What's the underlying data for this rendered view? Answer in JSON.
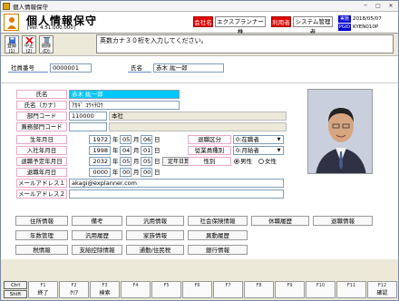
{
  "window": {
    "title": "個人情報保守"
  },
  "app": {
    "title": "個人情報保守",
    "version": "[Ver. 4.51.000.000]"
  },
  "header": {
    "company_label": "会社名",
    "company_value": "エクスプランナー株",
    "user_label": "利用者",
    "user_value": "システム管理者",
    "date_label": "実施日",
    "date_value": "2018/05/07",
    "pgid_label": "PGID",
    "pgid_value": "KYEN010P"
  },
  "toolbar": {
    "register": "登録\n(1)",
    "cancel": "中止\n(2)",
    "delete": "削除\n(D)"
  },
  "message": "英数カナ３０桁を入力してください。",
  "band": {
    "emp_no_label": "社員番号",
    "emp_no": "0000001",
    "name_label": "氏名",
    "name": "赤木 紘一郎"
  },
  "form": {
    "name_label": "氏名",
    "name": "赤木 紘一郎",
    "kana_label": "氏名（カナ）",
    "kana": "ｱｶｷﾞ ｺｳｲﾁﾛｳ",
    "dept_label": "部門コード",
    "dept_code": "110000",
    "dept_name": "本社",
    "duty_dept_label": "兼務部門コード",
    "duty_dept_code": "",
    "duty_dept_name": "",
    "birth_label": "生年月日",
    "birth": {
      "y": "1972",
      "m": "05",
      "d": "06"
    },
    "join_label": "入社年月日",
    "join": {
      "y": "1998",
      "m": "04",
      "d": "01"
    },
    "retire_plan_label": "退職予定年月日",
    "retire_plan": {
      "y": "2032",
      "m": "05",
      "d": "05"
    },
    "retire_calc": "定年日算出",
    "retire_label": "退職年月日",
    "retire": {
      "y": "0000",
      "m": "00",
      "d": "00"
    },
    "unit_y": "年",
    "unit_m": "月",
    "unit_d": "日",
    "status_label": "退職区分",
    "status": "0:在職者",
    "type_label": "従業員種別",
    "type": "0:月給者",
    "sex_label": "性別",
    "sex_male": "男性",
    "sex_female": "女性",
    "mail1_label": "メールアドレス１",
    "mail1": "akagi@explanner.com",
    "mail2_label": "メールアドレス２",
    "mail2": ""
  },
  "panel_buttons": {
    "row1": [
      "住所情報",
      "備考",
      "汎用情報",
      "社会保険情報",
      "休職履歴",
      "退職情報"
    ],
    "row2": [
      "年数管理",
      "汎用履歴",
      "家族情報",
      "異動履歴"
    ],
    "row3": [
      "税情報",
      "支給控除情報",
      "通勤/住民税",
      "銀行情報"
    ]
  },
  "fkeys": [
    {
      "fn": "F1",
      "label": "終了"
    },
    {
      "fn": "F2",
      "label": "ｸﾘｱ"
    },
    {
      "fn": "F3",
      "label": "検索"
    },
    {
      "fn": "F4",
      "label": ""
    },
    {
      "fn": "F5",
      "label": ""
    },
    {
      "fn": "F6",
      "label": ""
    },
    {
      "fn": "F7",
      "label": ""
    },
    {
      "fn": "F8",
      "label": ""
    },
    {
      "fn": "F9",
      "label": ""
    },
    {
      "fn": "F10",
      "label": ""
    },
    {
      "fn": "F11",
      "label": ""
    },
    {
      "fn": "F12",
      "label": "確認"
    }
  ],
  "ctl": {
    "ctrl": "Ctrl",
    "shift": "Shift"
  }
}
